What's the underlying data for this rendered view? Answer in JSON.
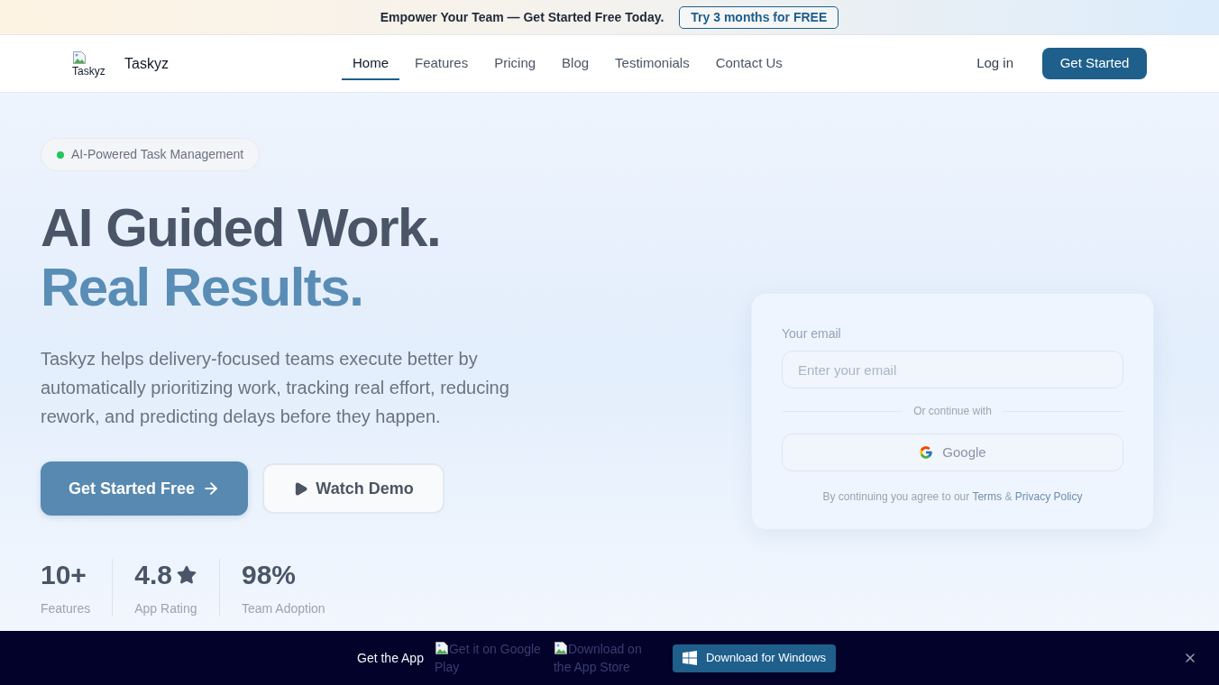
{
  "promo_banner": {
    "text": "Empower Your Team — Get Started Free Today.",
    "button": "Try 3 months for FREE"
  },
  "nav": {
    "logo_alt": "Taskyz",
    "brand": "Taskyz",
    "links": [
      {
        "label": "Home",
        "selected": true
      },
      {
        "label": "Features",
        "selected": false
      },
      {
        "label": "Pricing",
        "selected": false
      },
      {
        "label": "Blog",
        "selected": false
      },
      {
        "label": "Testimonials",
        "selected": false
      },
      {
        "label": "Contact Us",
        "selected": false
      }
    ],
    "login": "Log in",
    "cta": "Get Started"
  },
  "hero": {
    "badge": "AI-Powered Task Management",
    "headline": "AI Guided Work.",
    "headline_accent": "Real Results.",
    "description": "Taskyz helps delivery-focused teams execute better by automatically prioritizing work, tracking real effort, reducing rework, and predicting delays before they happen.",
    "primary_button": "Get Started Free",
    "secondary_button": "Watch Demo",
    "stats": [
      {
        "kind": "number",
        "value": "10+",
        "label": "Features"
      },
      {
        "kind": "rating",
        "value": "4.8",
        "label": "App Rating"
      },
      {
        "kind": "number",
        "value": "98%",
        "label": "Team Adoption"
      }
    ]
  },
  "signup_card": {
    "email_label": "Your email",
    "email_placeholder": "Enter your email",
    "divider": "Or continue with",
    "google_button": "Google",
    "legal": {
      "text": "By continuing you agree to our",
      "terms_link": "Terms",
      "joiner": "&",
      "privacy_link": "Privacy Policy"
    }
  },
  "app_bar": {
    "label": "Get the App",
    "store_badges": [
      {
        "alt": "Get it on Google Play"
      },
      {
        "alt": "Download on the App Store"
      }
    ],
    "windows_button": "Download for Windows"
  }
}
